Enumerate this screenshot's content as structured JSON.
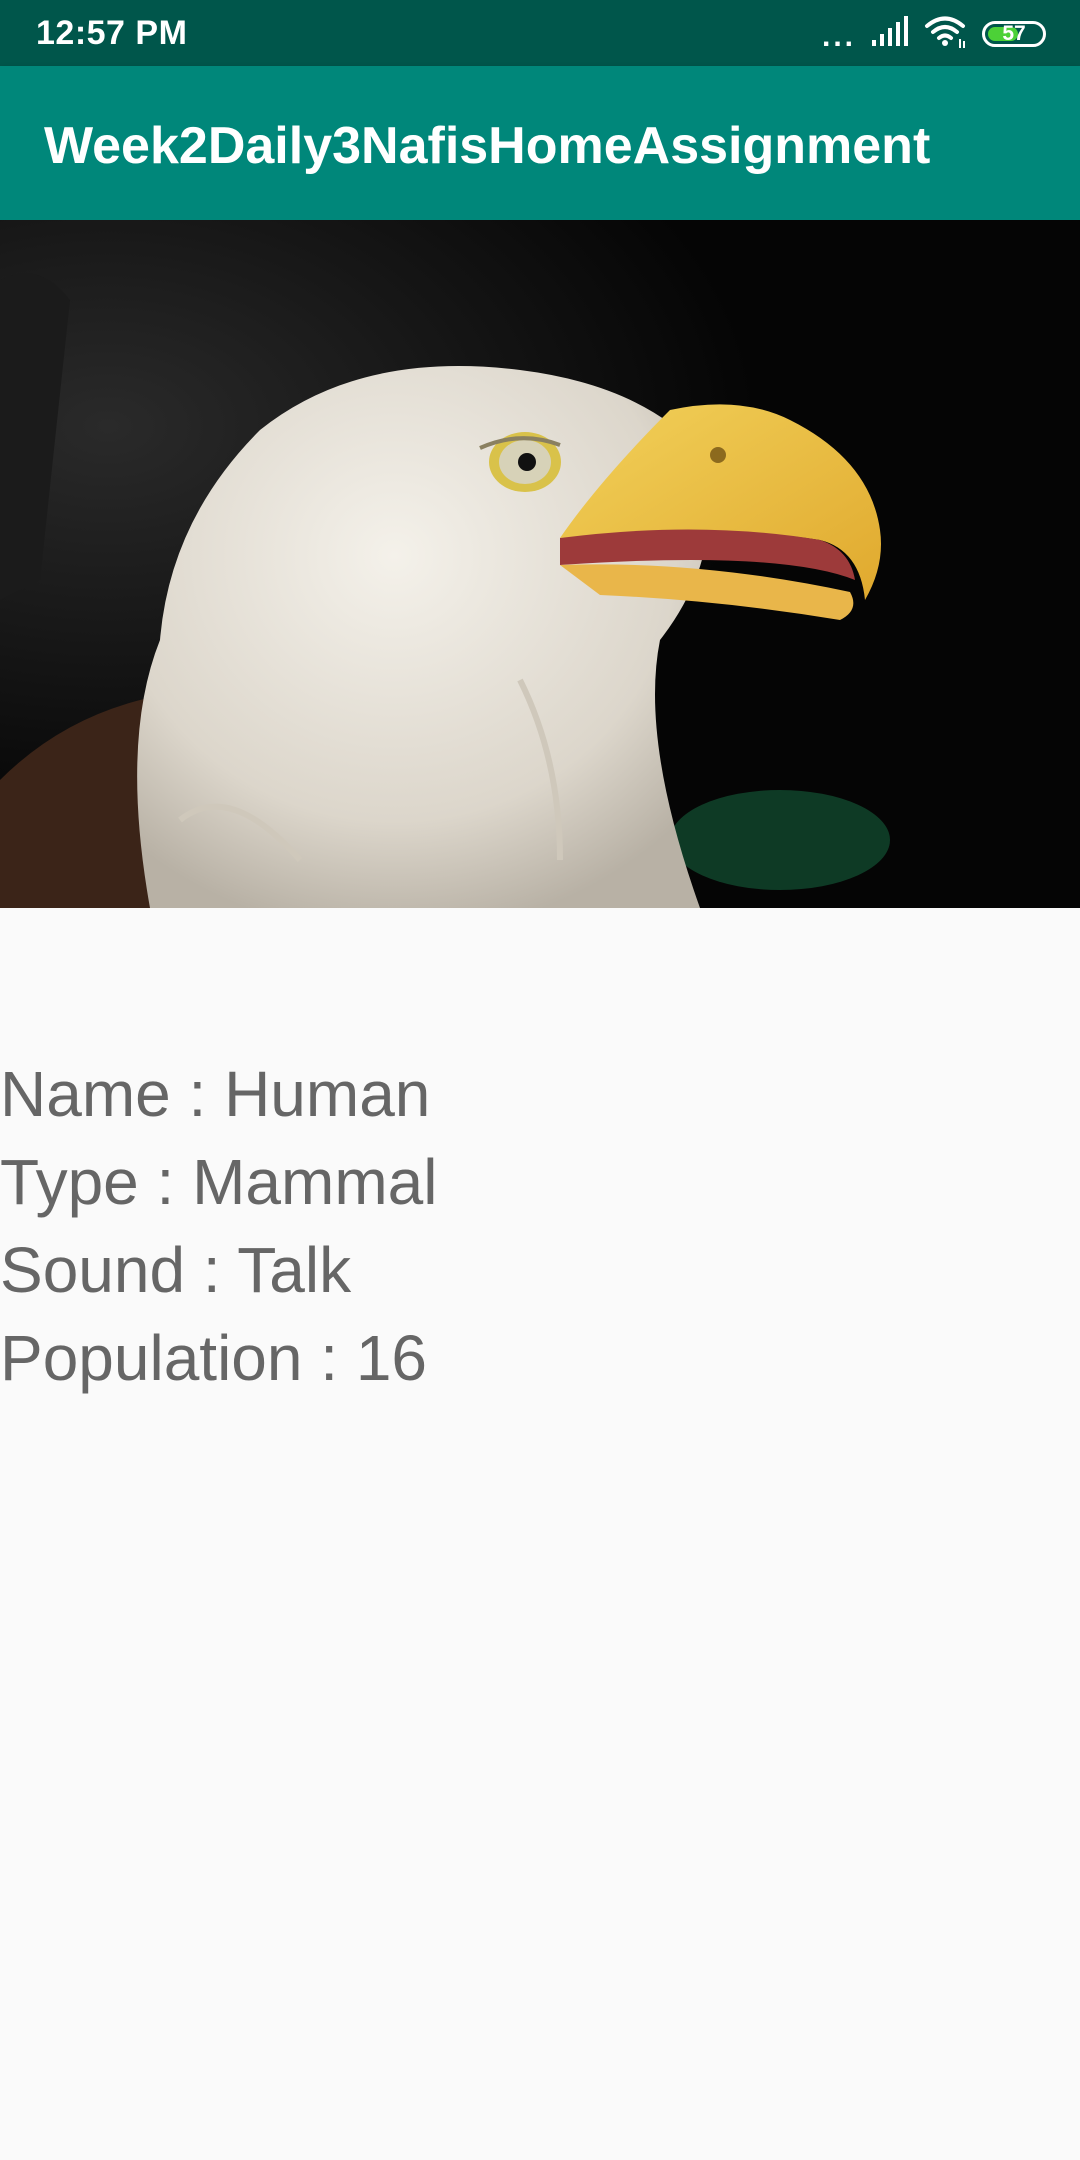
{
  "status_bar": {
    "time": "12:57 PM",
    "overflow_dots": "...",
    "battery_level": 57,
    "battery_label": "57",
    "icons": [
      "signal-icon",
      "wifi-icon",
      "battery-icon"
    ]
  },
  "app_bar": {
    "title": "Week2Daily3NafisHomeAssignment"
  },
  "animal": {
    "image": "bald-eagle-photo",
    "lines": [
      "Name : Human",
      "Type : Mammal",
      "Sound : Talk",
      "Population : 16"
    ]
  },
  "colors": {
    "status_bar": "#00564B",
    "app_bar": "#00877A",
    "background": "#FAFAFA",
    "text": "#666666",
    "battery": "#4CD137"
  }
}
